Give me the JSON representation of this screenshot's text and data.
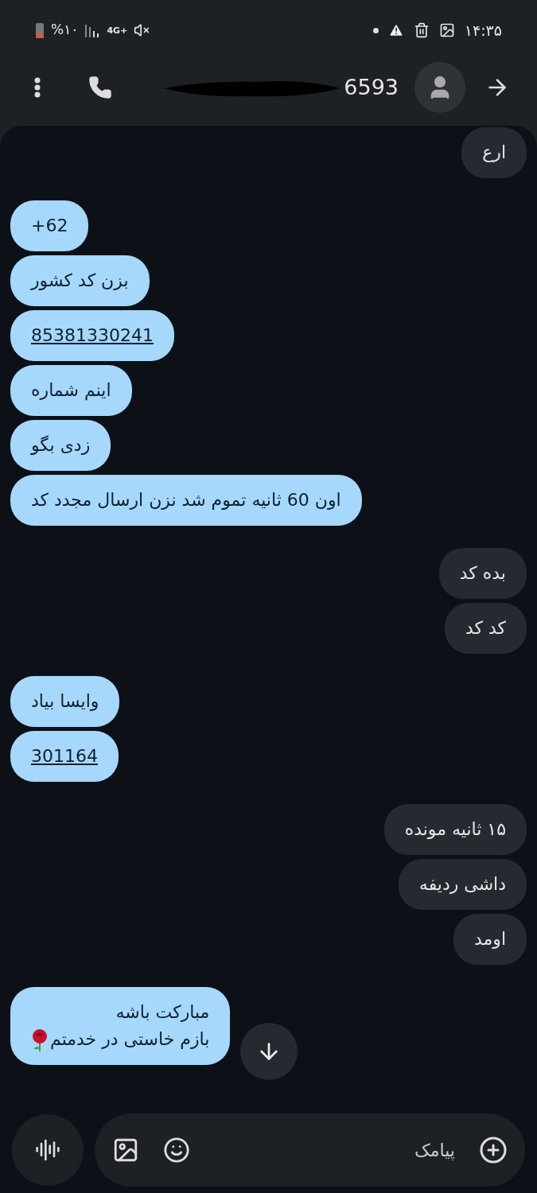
{
  "status_bar": {
    "battery": "%۱۰",
    "network": "4G+",
    "time": "۱۴:۳۵"
  },
  "header": {
    "contact": "6593"
  },
  "messages": [
    {
      "kind": "sent",
      "text": "ارع",
      "link": false
    },
    {
      "kind": "received",
      "text": "+62",
      "link": false
    },
    {
      "kind": "received",
      "text": "بزن کد کشور",
      "link": false
    },
    {
      "kind": "received",
      "text": "85381330241",
      "link": true
    },
    {
      "kind": "received",
      "text": "اینم شماره",
      "link": false
    },
    {
      "kind": "received",
      "text": "زدی بگو",
      "link": false
    },
    {
      "kind": "received",
      "text": "اون 60 ثانیه تموم شد نزن ارسال مجدد کد",
      "link": false
    },
    {
      "kind": "sent",
      "text": "بده کد",
      "link": false
    },
    {
      "kind": "sent",
      "text": "کد کد",
      "link": false
    },
    {
      "kind": "received",
      "text": "وایسا بیاد",
      "link": false
    },
    {
      "kind": "received",
      "text": "301164",
      "link": true
    },
    {
      "kind": "sent",
      "text": "۱۵ ثانیه مونده",
      "link": false
    },
    {
      "kind": "sent",
      "text": "داشی ردیفه",
      "link": false
    },
    {
      "kind": "sent",
      "text": "اومد",
      "link": false
    },
    {
      "kind": "received",
      "text": "مبارکت باشه\nبازم خاستی در خدمتم",
      "link": false,
      "rose": true
    }
  ],
  "composer": {
    "placeholder": "پیامک"
  }
}
